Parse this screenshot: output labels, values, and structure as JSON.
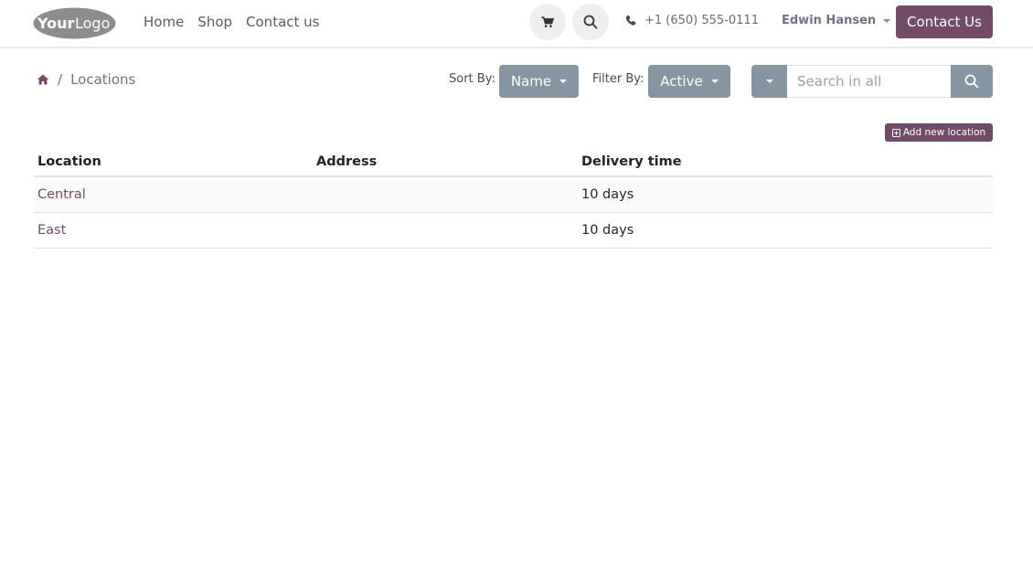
{
  "brand": {
    "logo_text_bold": "Your",
    "logo_text_light": "Logo"
  },
  "nav": {
    "links": [
      "Home",
      "Shop",
      "Contact us"
    ],
    "phone": "+1 (650) 555-0111",
    "user": "Edwin Hansen",
    "cta": "Contact Us"
  },
  "breadcrumb": {
    "current": "Locations",
    "separator": "/"
  },
  "sort": {
    "label": "Sort By:",
    "value": "Name"
  },
  "filter": {
    "label": "Filter By:",
    "value": "Active"
  },
  "search": {
    "placeholder": "Search in all"
  },
  "actions": {
    "add_label": "Add new location"
  },
  "table": {
    "headers": [
      "Location",
      "Address",
      "Delivery time"
    ],
    "rows": [
      {
        "location": "Central",
        "address": "",
        "delivery": "10 days"
      },
      {
        "location": "East",
        "address": "",
        "delivery": "10 days"
      }
    ]
  },
  "colors": {
    "brand": "#714b67",
    "secondary": "#8595a2"
  },
  "icons": [
    "cart-icon",
    "search-icon",
    "phone-icon",
    "home-icon",
    "plus-square-icon",
    "chevron-down-icon"
  ]
}
